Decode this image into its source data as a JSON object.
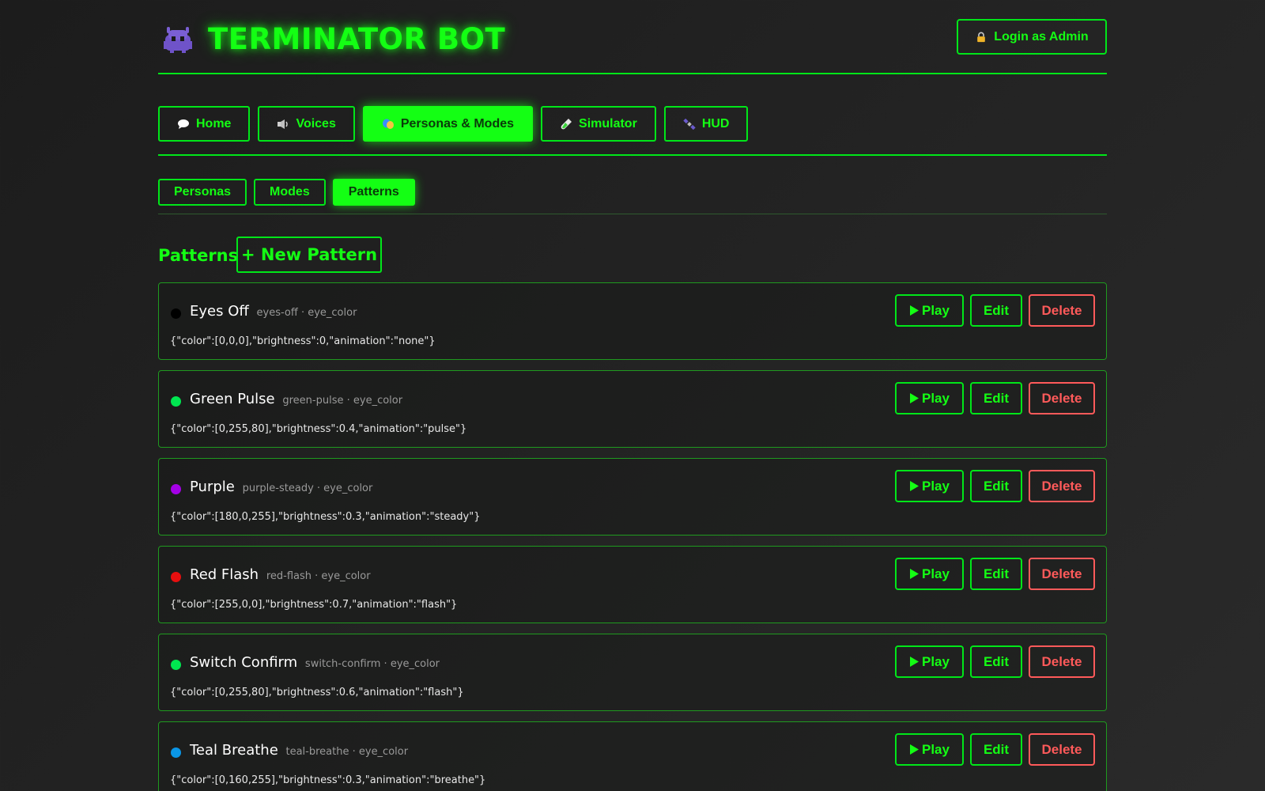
{
  "app": {
    "title": "TERMINATOR BOT",
    "login_label": "Login as Admin"
  },
  "nav": {
    "items": [
      {
        "label": "Home",
        "icon": "speech-bubble-icon",
        "active": false
      },
      {
        "label": "Voices",
        "icon": "speaker-icon",
        "active": false
      },
      {
        "label": "Personas & Modes",
        "icon": "theater-masks-icon",
        "active": true
      },
      {
        "label": "Simulator",
        "icon": "test-tube-icon",
        "active": false
      },
      {
        "label": "HUD",
        "icon": "satellite-icon",
        "active": false
      }
    ]
  },
  "subnav": {
    "items": [
      {
        "label": "Personas",
        "active": false
      },
      {
        "label": "Modes",
        "active": false
      },
      {
        "label": "Patterns",
        "active": true
      }
    ]
  },
  "section": {
    "title": "Patterns",
    "new_button_label": "+ New Pattern"
  },
  "actions": {
    "play": "Play",
    "edit": "Edit",
    "delete": "Delete"
  },
  "patterns": [
    {
      "name": "Eyes Off",
      "meta": "eyes-off · eye_color",
      "json": "{\"color\":[0,0,0],\"brightness\":0,\"animation\":\"none\"}",
      "color": "#000000"
    },
    {
      "name": "Green Pulse",
      "meta": "green-pulse · eye_color",
      "json": "{\"color\":[0,255,80],\"brightness\":0.4,\"animation\":\"pulse\"}",
      "color": "#00e650"
    },
    {
      "name": "Purple",
      "meta": "purple-steady · eye_color",
      "json": "{\"color\":[180,0,255],\"brightness\":0.3,\"animation\":\"steady\"}",
      "color": "#a400e6"
    },
    {
      "name": "Red Flash",
      "meta": "red-flash · eye_color",
      "json": "{\"color\":[255,0,0],\"brightness\":0.7,\"animation\":\"flash\"}",
      "color": "#e60f0f"
    },
    {
      "name": "Switch Confirm",
      "meta": "switch-confirm · eye_color",
      "json": "{\"color\":[0,255,80],\"brightness\":0.6,\"animation\":\"flash\"}",
      "color": "#00e650"
    },
    {
      "name": "Teal Breathe",
      "meta": "teal-breathe · eye_color",
      "json": "{\"color\":[0,160,255],\"brightness\":0.3,\"animation\":\"breathe\"}",
      "color": "#0a96e6"
    }
  ],
  "colors": {
    "accent": "#14ff14",
    "danger": "#ff5a5a",
    "background": "#1e1e1e"
  }
}
